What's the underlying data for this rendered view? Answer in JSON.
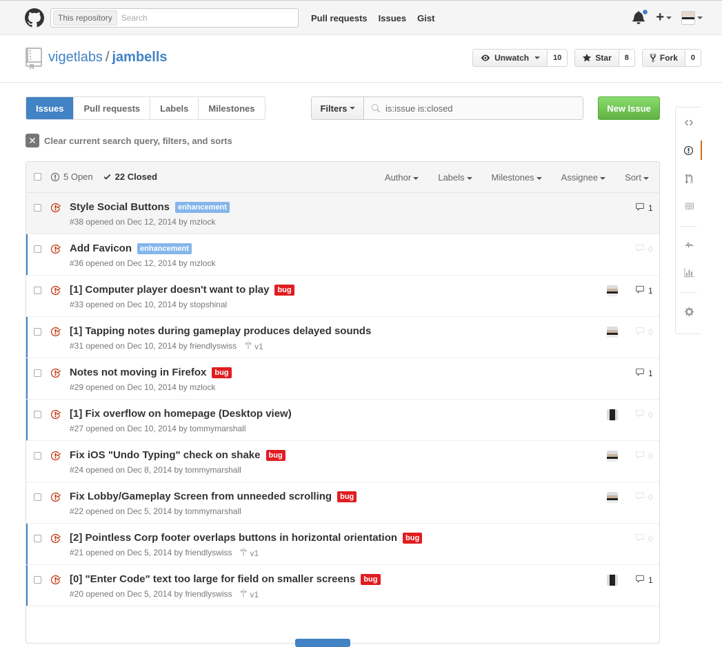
{
  "header": {
    "search_scope": "This repository",
    "search_placeholder": "Search",
    "nav": [
      "Pull requests",
      "Issues",
      "Gist"
    ],
    "plus_label": "+"
  },
  "repo": {
    "owner": "vigetlabs",
    "separator": "/",
    "name": "jambells",
    "unwatch_label": "Unwatch",
    "unwatch_count": "10",
    "star_label": "Star",
    "star_count": "8",
    "fork_label": "Fork",
    "fork_count": "0"
  },
  "toolbar": {
    "tabs": [
      "Issues",
      "Pull requests",
      "Labels",
      "Milestones"
    ],
    "filters_label": "Filters",
    "filter_query": "is:issue is:closed",
    "new_issue_label": "New Issue",
    "clear_label": "Clear current search query, filters, and sorts"
  },
  "list": {
    "open_label": "5 Open",
    "closed_label": "22 Closed",
    "filters": [
      "Author",
      "Labels",
      "Milestones",
      "Assignee",
      "Sort"
    ],
    "issues": [
      {
        "title": "Style Social Buttons",
        "label": "enhancement",
        "label_color": "#84b6eb",
        "meta": "#38 opened on Dec 12, 2014 by mzlock",
        "milestone": "",
        "comments": "1"
      },
      {
        "title": "Add Favicon",
        "label": "enhancement",
        "label_color": "#84b6eb",
        "meta": "#36 opened on Dec 12, 2014 by mzlock",
        "milestone": "",
        "comments": "0"
      },
      {
        "title": "[1] Computer player doesn't want to play",
        "label": "bug",
        "label_color": "#e11d21",
        "meta": "#33 opened on Dec 10, 2014 by stopshinal",
        "milestone": "",
        "comments": "1"
      },
      {
        "title": "[1] Tapping notes during gameplay produces delayed sounds",
        "label": "",
        "label_color": "",
        "meta": "#31 opened on Dec 10, 2014 by friendlyswiss",
        "milestone": "v1",
        "comments": "0"
      },
      {
        "title": "Notes not moving in Firefox",
        "label": "bug",
        "label_color": "#e11d21",
        "meta": "#29 opened on Dec 10, 2014 by mzlock",
        "milestone": "",
        "comments": "1"
      },
      {
        "title": "[1] Fix overflow on homepage (Desktop view)",
        "label": "",
        "label_color": "",
        "meta": "#27 opened on Dec 10, 2014 by tommymarshall",
        "milestone": "",
        "comments": "0"
      },
      {
        "title": "Fix iOS \"Undo Typing\" check on shake",
        "label": "bug",
        "label_color": "#e11d21",
        "meta": "#24 opened on Dec 8, 2014 by tommymarshall",
        "milestone": "",
        "comments": "0"
      },
      {
        "title": "Fix Lobby/Gameplay Screen from unneeded scrolling",
        "label": "bug",
        "label_color": "#e11d21",
        "meta": "#22 opened on Dec 5, 2014 by tommymarshall",
        "milestone": "",
        "comments": "0"
      },
      {
        "title": "[2] Pointless Corp footer overlaps buttons in horizontal orientation",
        "label": "bug",
        "label_color": "#e11d21",
        "meta": "#21 opened on Dec 5, 2014 by friendlyswiss",
        "milestone": "v1",
        "comments": "0"
      },
      {
        "title": "[0] \"Enter Code\" text too large for field on smaller screens",
        "label": "bug",
        "label_color": "#e11d21",
        "meta": "#20 opened on Dec 5, 2014 by friendlyswiss",
        "milestone": "v1",
        "comments": "1"
      }
    ]
  },
  "colors": {
    "accent": "#4183c4",
    "closed_icon": "#bd2c00",
    "new_issue": "#60b044",
    "side_active": "#d26911"
  }
}
